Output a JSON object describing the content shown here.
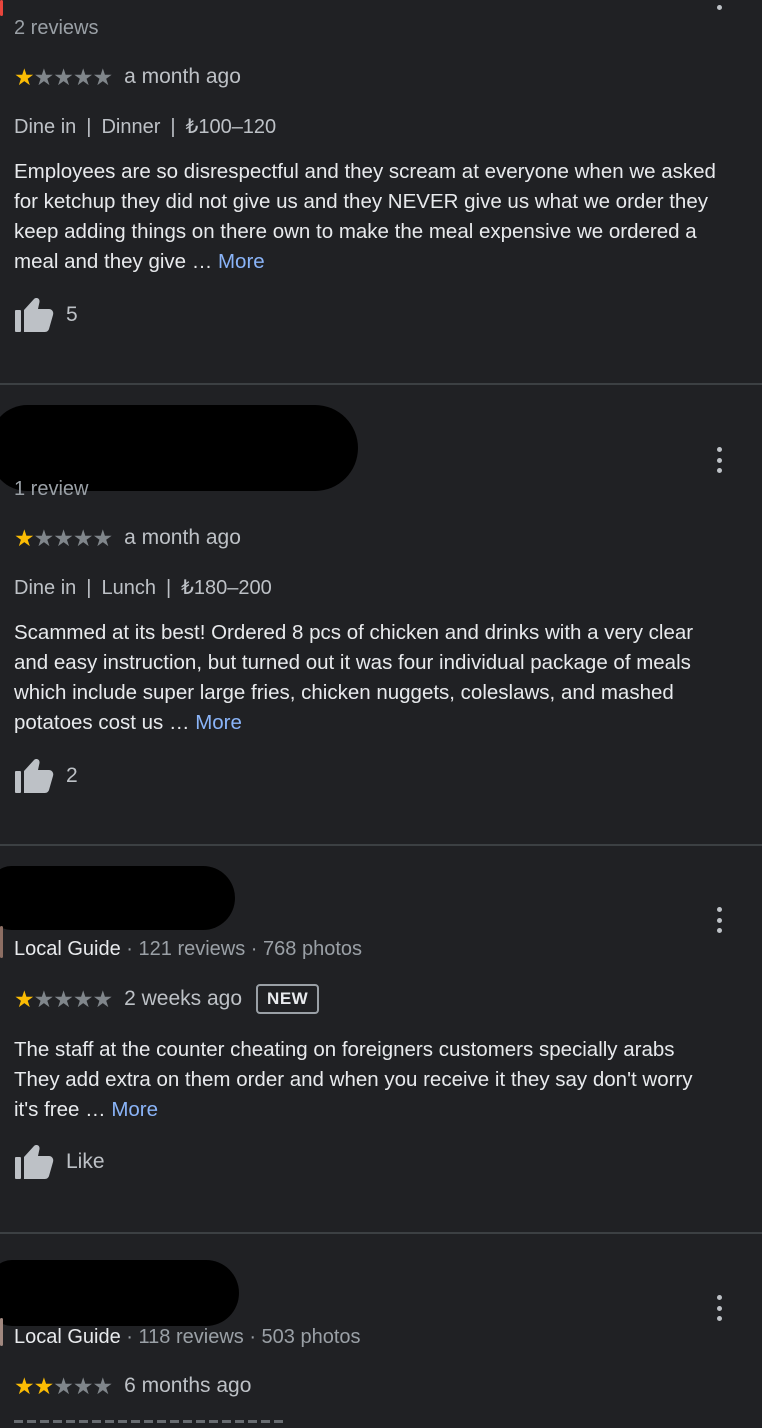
{
  "reviews": [
    {
      "meta": {
        "reviews": "2 reviews"
      },
      "stars": 1,
      "when": "a month ago",
      "tags": [
        "Dine in",
        "Dinner",
        "₺100–120"
      ],
      "lines": [
        "Employees are so disrespectful and they scream at everyone when we asked",
        "for ketchup they did not give us and they NEVER give us what we order they",
        "keep adding things on there own to make the meal expensive we ordered a",
        "meal and they give … "
      ],
      "more_label": "More",
      "likes": "5"
    },
    {
      "meta": {
        "reviews": "1 review"
      },
      "stars": 1,
      "when": "a month ago",
      "tags": [
        "Dine in",
        "Lunch",
        "₺180–200"
      ],
      "lines": [
        "Scammed at its best! Ordered 8 pcs of chicken and drinks with a very clear",
        "and easy instruction, but turned out it was four individual package of meals",
        "which include super large fries, chicken nuggets, coleslaws, and mashed",
        "potatoes cost us … "
      ],
      "more_label": "More",
      "likes": "2"
    },
    {
      "meta": {
        "guide": "Local Guide",
        "reviews": "121 reviews",
        "photos": "768 photos"
      },
      "stars": 1,
      "when": "2 weeks ago",
      "badge": "NEW",
      "lines": [
        "The staff at the counter cheating on foreigners customers specially arabs",
        "They add extra on them order and when you receive it they say don't worry",
        "it's free … "
      ],
      "more_label": "More",
      "likes": "Like"
    },
    {
      "meta": {
        "guide": "Local Guide",
        "reviews": "118 reviews",
        "photos": "503 photos"
      },
      "stars": 2,
      "when": "6 months ago"
    }
  ],
  "colors": {
    "background": "#202124",
    "star_filled": "#fbbc04",
    "star_empty": "#80868b",
    "link": "#8ab4f8",
    "divider": "#3c4043"
  },
  "icons": {
    "like": "thumbs-up-icon",
    "menu": "more-vert-icon",
    "star": "star-icon"
  }
}
